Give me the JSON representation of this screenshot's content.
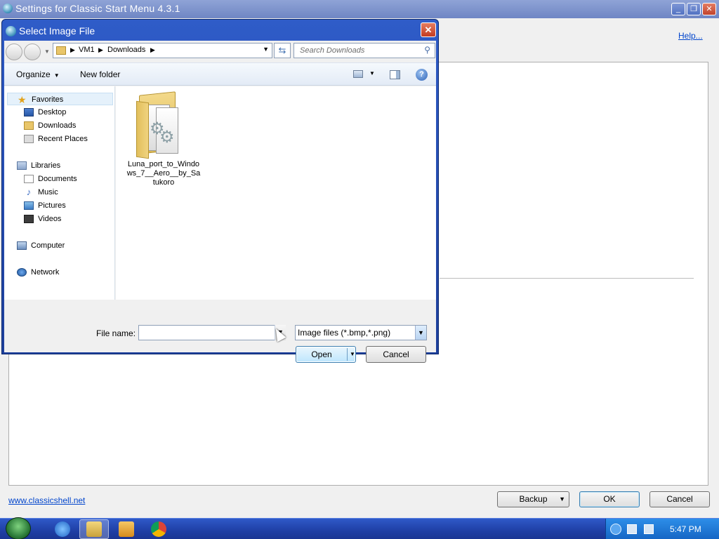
{
  "app_window": {
    "title": "Settings for Classic Start Menu 4.3.1",
    "help_link": "Help...",
    "website_link": "www.classicshell.net",
    "backup_label": "Backup",
    "ok_label": "OK",
    "cancel_label": "Cancel"
  },
  "dialog": {
    "title": "Select Image File",
    "breadcrumbs": [
      "VM1",
      "Downloads"
    ],
    "search_placeholder": "Search Downloads",
    "organize_label": "Organize",
    "new_folder_label": "New folder",
    "nav": {
      "favorites": {
        "label": "Favorites",
        "items": [
          {
            "label": "Desktop",
            "icon": "desktop-icon"
          },
          {
            "label": "Downloads",
            "icon": "downloads-folder-icon"
          },
          {
            "label": "Recent Places",
            "icon": "recent-places-icon"
          }
        ]
      },
      "libraries": {
        "label": "Libraries",
        "items": [
          {
            "label": "Documents",
            "icon": "documents-icon"
          },
          {
            "label": "Music",
            "icon": "music-icon"
          },
          {
            "label": "Pictures",
            "icon": "pictures-icon"
          },
          {
            "label": "Videos",
            "icon": "videos-icon"
          }
        ]
      },
      "computer": "Computer",
      "network": "Network"
    },
    "files": [
      {
        "name": "Luna_port_to_Windows_7__Aero__by_Satukoro",
        "icon": "folder-icon"
      }
    ],
    "file_name_label": "File name:",
    "file_name_value": "",
    "file_type": "Image files (*.bmp,*.png)",
    "open_label": "Open",
    "cancel_label": "Cancel"
  },
  "taskbar": {
    "clock": "5:47 PM"
  }
}
